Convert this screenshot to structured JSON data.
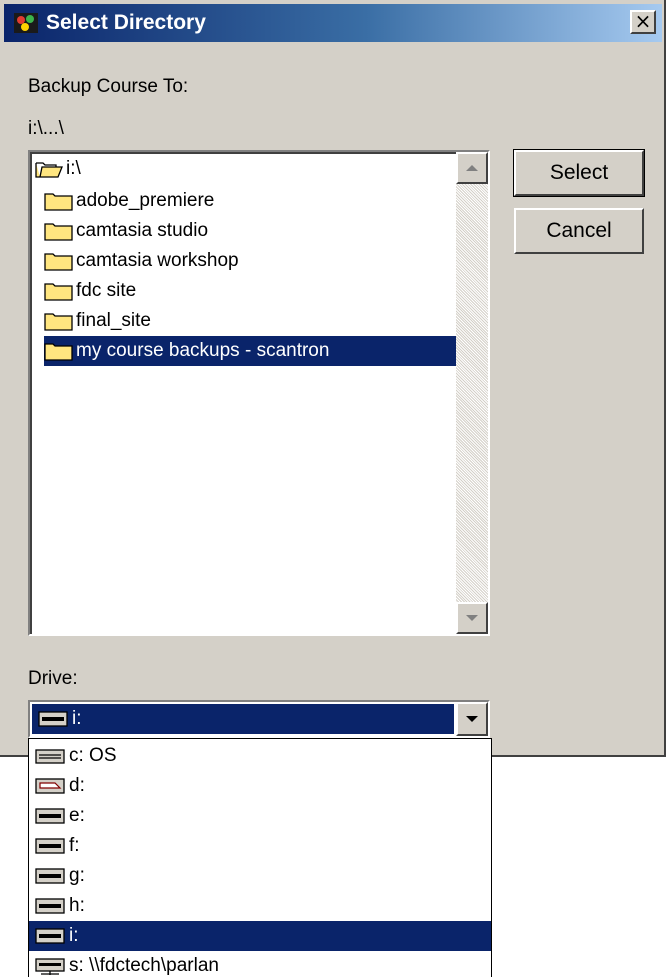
{
  "window": {
    "title": "Select Directory",
    "close_label": "×"
  },
  "backup_label": "Backup Course To:",
  "current_path": "i:\\...\\",
  "tree": {
    "items": [
      {
        "label": "i:\\",
        "icon": "open-folder-icon",
        "selected": false
      },
      {
        "label": "adobe_premiere",
        "icon": "folder-icon",
        "selected": false
      },
      {
        "label": "camtasia studio",
        "icon": "folder-icon",
        "selected": false
      },
      {
        "label": "camtasia workshop",
        "icon": "folder-icon",
        "selected": false
      },
      {
        "label": "fdc site",
        "icon": "folder-icon",
        "selected": false
      },
      {
        "label": "final_site",
        "icon": "folder-icon",
        "selected": false
      },
      {
        "label": "my course backups - scantron",
        "icon": "folder-icon",
        "selected": true
      }
    ]
  },
  "buttons": {
    "select": "Select",
    "cancel": "Cancel"
  },
  "drive": {
    "label": "Drive:",
    "selected": "i:",
    "options": [
      {
        "label": "c: OS",
        "icon": "hard-drive-icon",
        "selected": false
      },
      {
        "label": "d:",
        "icon": "cd-drive-icon",
        "selected": false
      },
      {
        "label": "e:",
        "icon": "removable-drive-icon",
        "selected": false
      },
      {
        "label": "f:",
        "icon": "removable-drive-icon",
        "selected": false
      },
      {
        "label": "g:",
        "icon": "removable-drive-icon",
        "selected": false
      },
      {
        "label": "h:",
        "icon": "removable-drive-icon",
        "selected": false
      },
      {
        "label": "i:",
        "icon": "removable-drive-icon",
        "selected": true
      },
      {
        "label": "s: \\\\fdctech\\parlan",
        "icon": "network-drive-icon",
        "selected": false
      }
    ]
  },
  "colors": {
    "dialog_bg": "#d4d0c8",
    "selection": "#0a246a",
    "folder_yellow": "#ffe680"
  }
}
